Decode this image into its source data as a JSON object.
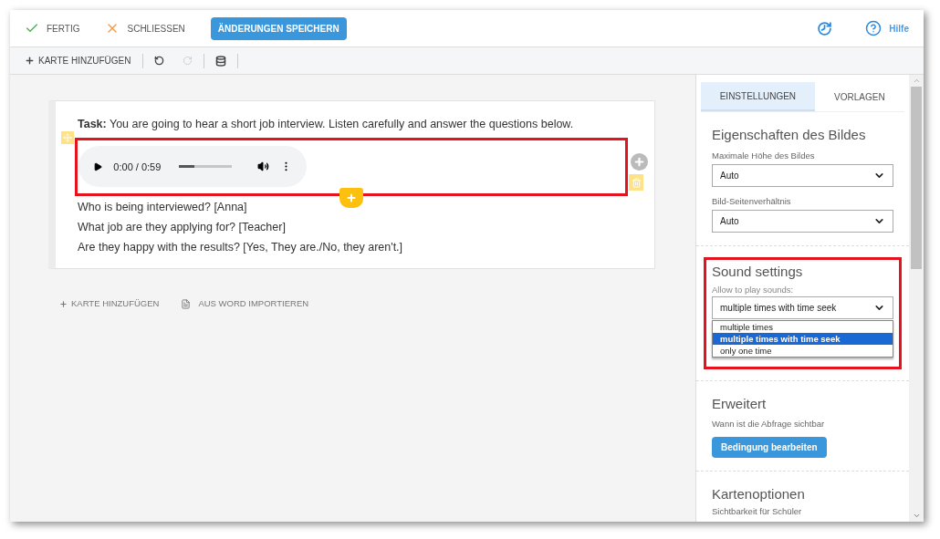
{
  "top_bar": {
    "done": "FERTIG",
    "close": "SCHLIESSEN",
    "save": "ÄNDERUNGEN SPEICHERN",
    "help": "Hilfe"
  },
  "toolbar": {
    "add_card": "KARTE HINZUFÜGEN",
    "redo_disabled": true
  },
  "card": {
    "task": "**Task:** You are going to hear a short job interview. Listen carefully and answer the questions below.",
    "audio": {
      "time": "0:00 / 0:59",
      "level": 0.28
    },
    "questions": [
      "Who is being interviewed? [Anna]",
      "What job are they applying for? [Teacher]",
      "Are they happy with the results? [Yes, They are./No, they aren't.]"
    ]
  },
  "below_card": {
    "add_card": "KARTE HINZUFÜGEN",
    "import": "AUS WORD IMPORTIEREN"
  },
  "sidebar": {
    "tabs": [
      {
        "label": "EINSTELLUNGEN",
        "selected": true
      },
      {
        "label": "VORLAGEN",
        "selected": false
      }
    ],
    "image_section": {
      "title": "Eigenschaften des Bildes",
      "fields": [
        {
          "label": "Maximale Höhe des Bildes",
          "value": "Auto"
        },
        {
          "label": "Bild-Seitenverhältnis",
          "value": "Auto"
        }
      ]
    },
    "sound_section": {
      "title": "Sound settings",
      "label": "Allow to play sounds:",
      "value": "multiple times with time seek",
      "options": [
        {
          "label": "multiple times",
          "selected": false
        },
        {
          "label": "multiple times with time seek",
          "selected": true
        },
        {
          "label": "only one time",
          "selected": false
        }
      ]
    },
    "advanced_section": {
      "title": "Erweitert",
      "text": "Wann ist die Abfrage sichtbar",
      "button": "Bedingung bearbeiten"
    },
    "card_options": {
      "title": "Kartenoptionen",
      "text": "Sichtbarkeit für Schüler"
    }
  }
}
